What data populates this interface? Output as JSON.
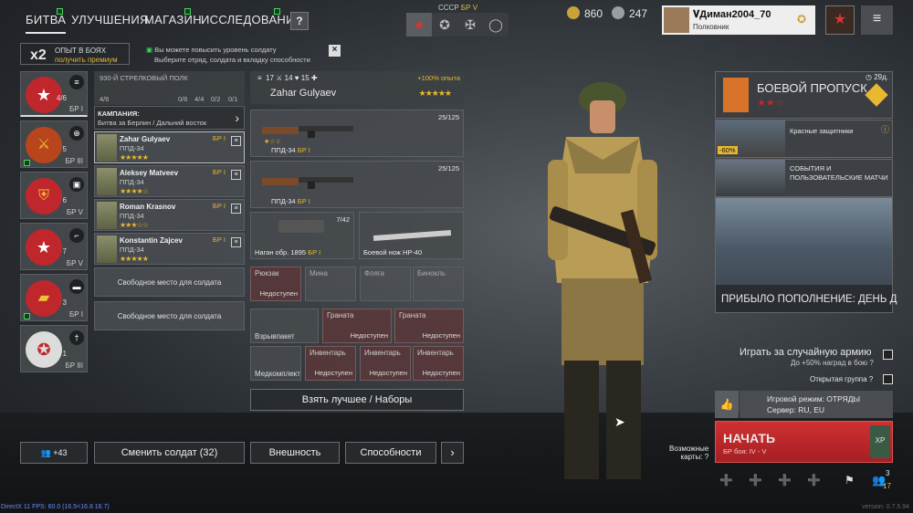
{
  "nav": {
    "battle": "БИТВА",
    "upgrades": "УЛУЧШЕНИЯ",
    "shop": "МАГАЗИН",
    "research": "ИССЛЕДОВАНИЯ",
    "help": "?"
  },
  "army": {
    "label": "СССР",
    "br": "БР V"
  },
  "currency": {
    "gold": "860",
    "silver": "247"
  },
  "profile": {
    "name": "𝐕Диман2004_70",
    "rank": "Полковник"
  },
  "exp_bonus": {
    "multiplier": "x2",
    "title": "ОПЫТ В БОЯХ",
    "premium": "получить премиум"
  },
  "tip": {
    "line1": "Вы можете повысить уровень солдату",
    "line2": "Выберите отряд, солдата и вкладку способности"
  },
  "squads": [
    {
      "count": "4/6",
      "br": "БР I",
      "icon": "list-icon"
    },
    {
      "count": "5",
      "br": "БР III",
      "icon": "target-icon"
    },
    {
      "count": "6",
      "br": "БР V",
      "icon": "vehicle-icon"
    },
    {
      "count": "7",
      "br": "БР V",
      "icon": "gun-icon"
    },
    {
      "count": "3",
      "br": "БР I",
      "icon": "tank-icon"
    },
    {
      "count": "1",
      "br": "БР III",
      "icon": "sword-icon"
    }
  ],
  "regiment": {
    "name": "930-Й СТРЕЛКОВЫЙ ПОЛК",
    "s1": "4/6",
    "s2": "0/6",
    "s3": "4/4",
    "s4": "0/2",
    "s5": "0/1",
    "campaign_label": "КАМПАНИЯ:",
    "campaign": "Битва за Берлин / Дальний восток"
  },
  "soldiers": [
    {
      "name": "Zahar Gulyaev",
      "weapon": "ППД-34",
      "br": "БР I",
      "stars": "★★★★★"
    },
    {
      "name": "Aleksey Matveev",
      "weapon": "ППД-34",
      "br": "БР I",
      "stars": "★★★★☆"
    },
    {
      "name": "Roman Krasnov",
      "weapon": "ППД-34",
      "br": "БР I",
      "stars": "★★★☆☆"
    },
    {
      "name": "Konstantin Zajcev",
      "weapon": "ППД-34",
      "br": "БР I",
      "stars": "★★★★★"
    }
  ],
  "free_slot": "Свободное место для солдата",
  "selected": {
    "stat1": "17",
    "stat2": "14",
    "stat3": "15",
    "bonus": "+100% опыта",
    "name": "Zahar Gulyaev",
    "stars": "★★★★★"
  },
  "weapons": [
    {
      "name": "ППД-34",
      "br": "БР I",
      "ammo": "25/125",
      "stars": "★☆☆"
    },
    {
      "name": "ППД-34",
      "br": "БР I",
      "ammo": "25/125",
      "stars": ""
    }
  ],
  "sidearm": {
    "name": "Наган обр. 1895",
    "br": "БР I",
    "ammo": "7/42"
  },
  "melee": {
    "name": "Боевой нож НР-40"
  },
  "slots": {
    "backpack": "Рюкзак",
    "mine": "Мина",
    "flask": "Фляга",
    "binoculars": "Бинокль",
    "unavailable": "Недоступен",
    "explosive": "Взрывпакет",
    "grenade": "Граната",
    "medkit": "Медкомплект",
    "inventory": "Инвентарь"
  },
  "take_best": "Взять лучшее / Наборы",
  "bottom": {
    "friends": "+43",
    "change": "Сменить солдат (32)",
    "look": "Внешность",
    "abilities": "Способности",
    "next": "›"
  },
  "bp": {
    "title": "БОЕВОЙ ПРОПУСК",
    "days": "29д.",
    "stars": "★★☆"
  },
  "promos": [
    {
      "title": "Красные защитники",
      "discount": "-60%"
    },
    {
      "title": "СОБЫТИЯ И ПОЛЬЗОВАТЕЛЬСКИЕ МАТЧИ"
    }
  ],
  "banner": "ПРИБЫЛО ПОПОЛНЕНИЕ: ДЕНЬ Д",
  "options": {
    "random_army": "Играть за случайную армию",
    "random_bonus": "До +50% наград в бою",
    "open_group": "Открытая группа"
  },
  "mode": {
    "line1": "Игровой режим: ОТРЯДЫ",
    "line2": "Сервер: RU, EU"
  },
  "start": {
    "label": "НАЧАТЬ",
    "br": "БР боя: IV - V"
  },
  "maps": {
    "line1": "Возможные",
    "line2": "карты:"
  },
  "group_count": {
    "top": "3",
    "bottom": "17"
  },
  "footer": {
    "fps": "DirectX 11 FPS: 60.0 (16.5<16.8 16.7)",
    "version": "version: 0.7.5.94"
  },
  "colors": {
    "accent": "#e8b830",
    "red": "#c0272d",
    "green": "#3fdc5a"
  }
}
